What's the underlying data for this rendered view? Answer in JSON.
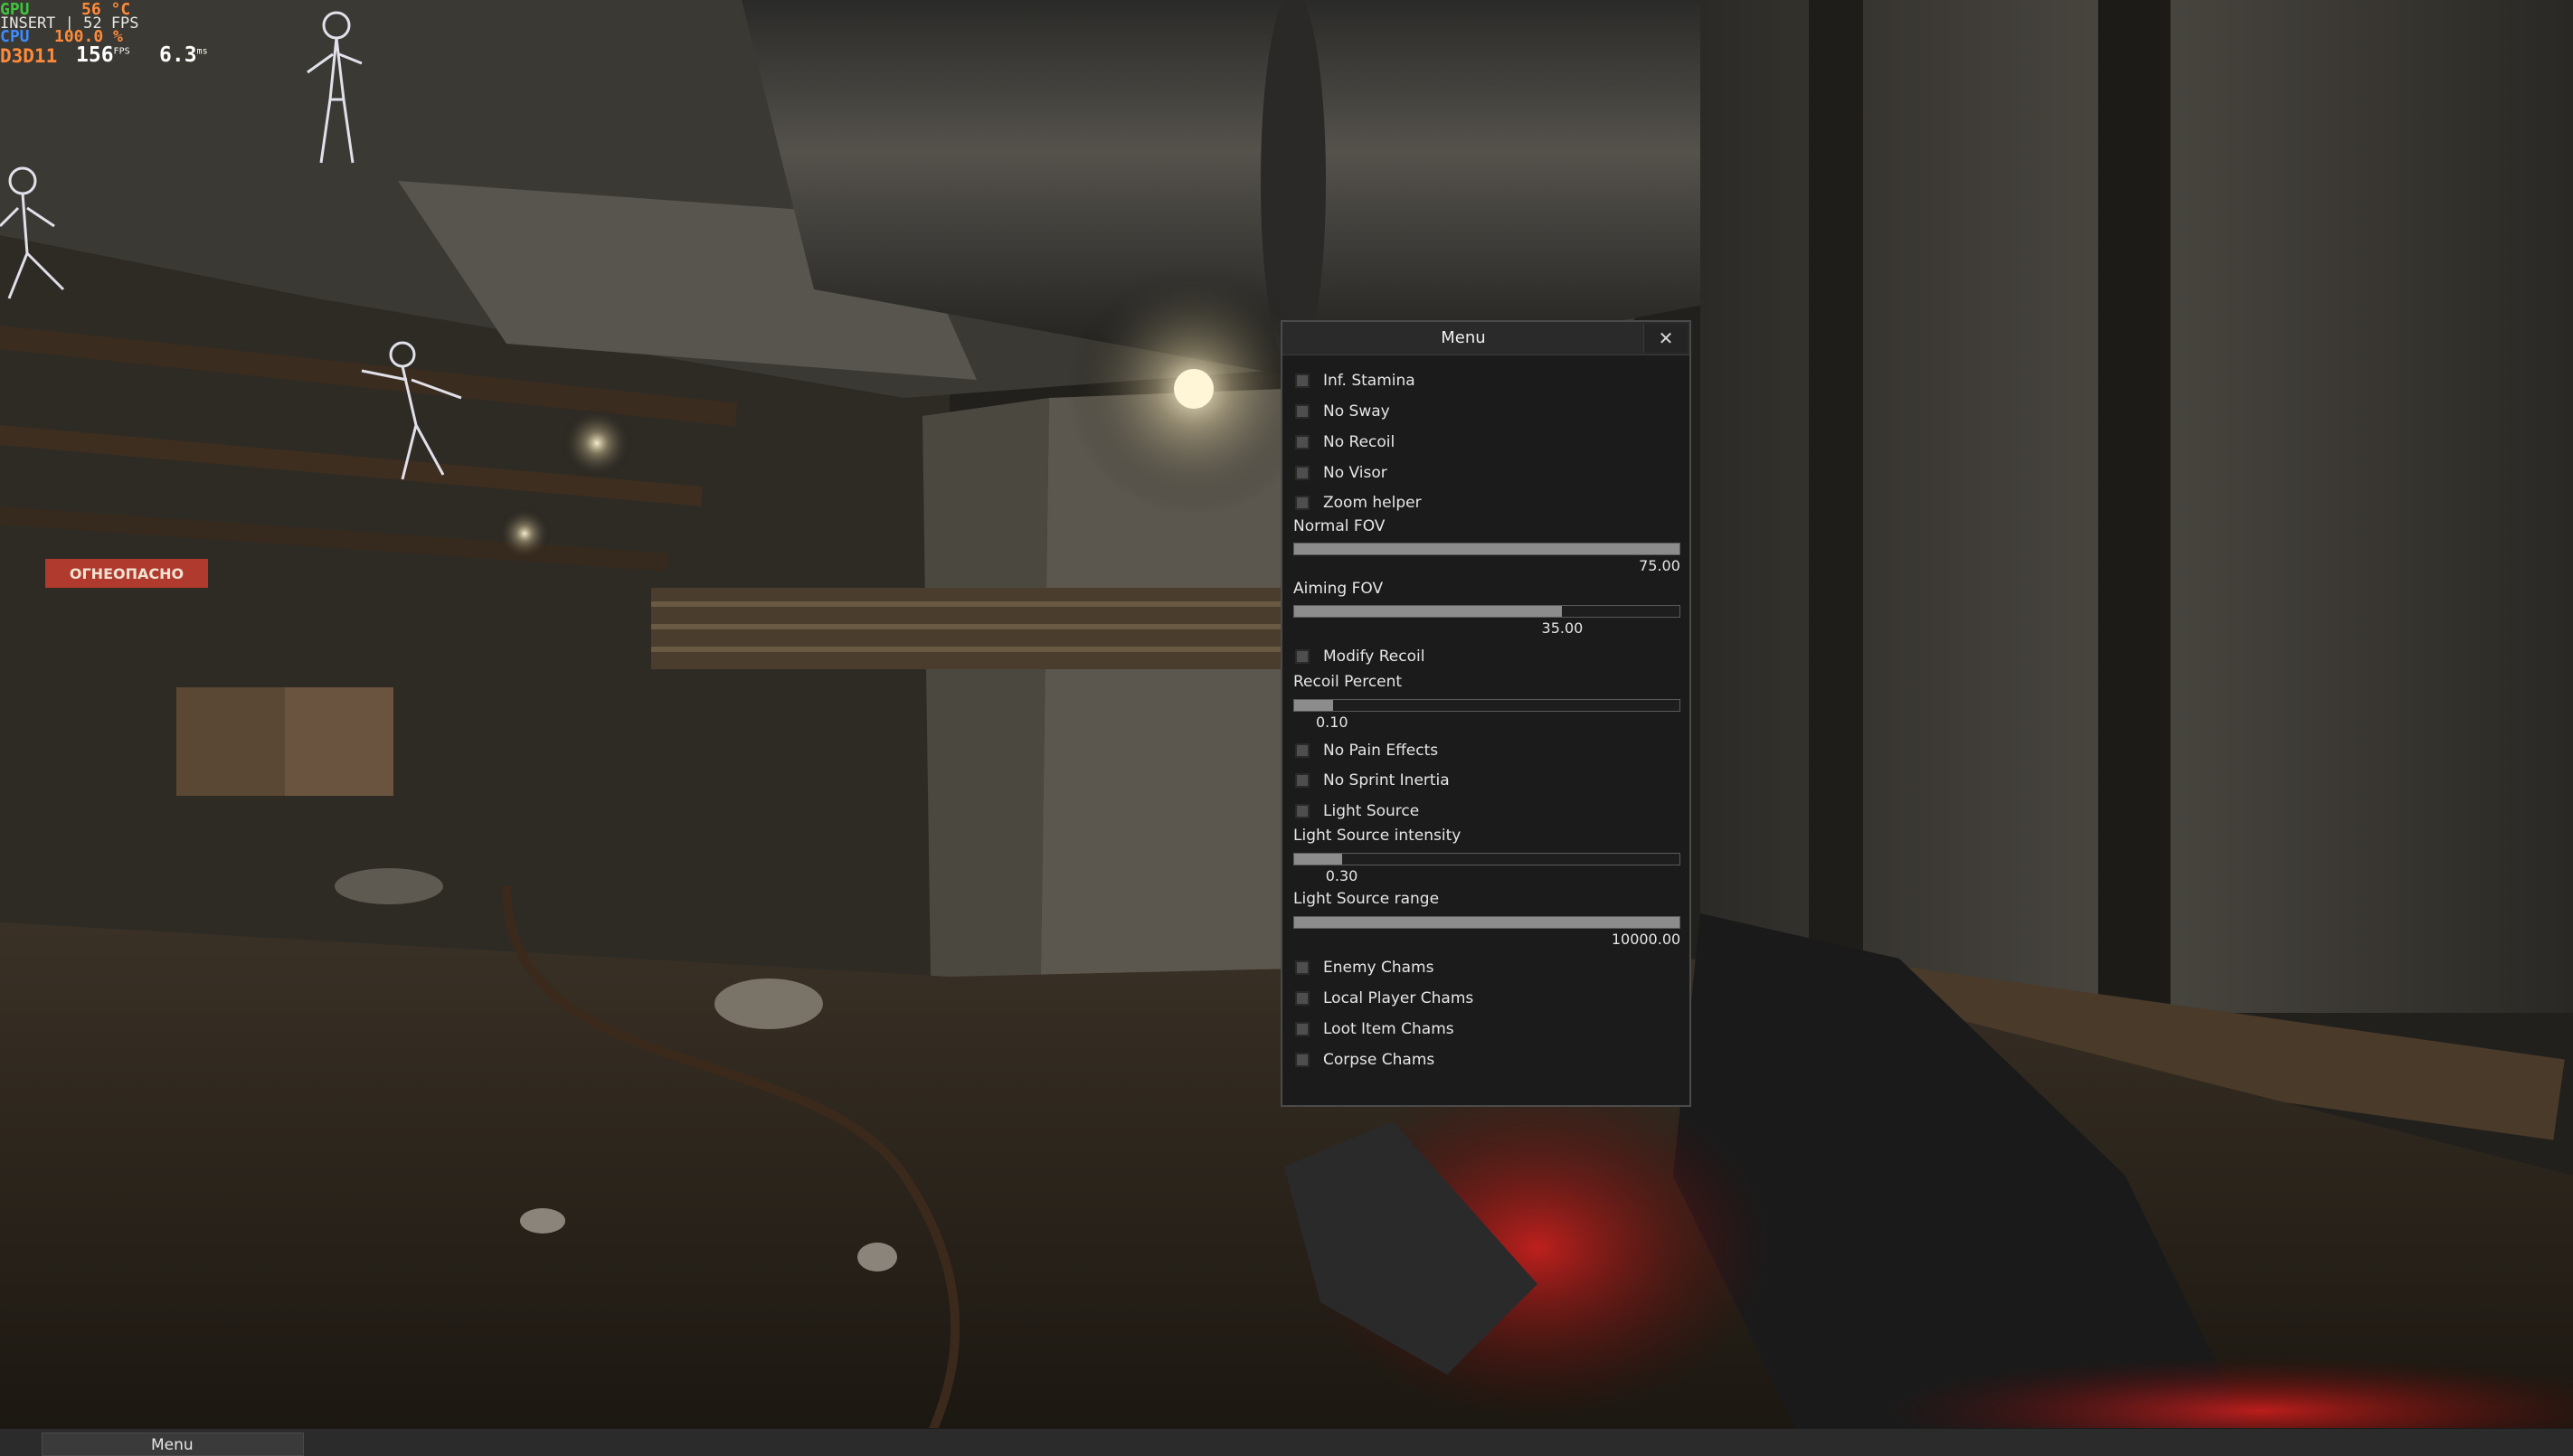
{
  "overlay": {
    "gpu_label": "GPU",
    "gpu_value": "56 °C",
    "hint": "INSERT | 52 FPS",
    "cpu_label": "CPU",
    "cpu_value": "100.0 %",
    "api": "D3D11",
    "fps_value": "156",
    "fps_unit": "FPS",
    "ms_value": "6.3",
    "ms_unit": "ms"
  },
  "scene": {
    "sign_text": "ОГНЕОПАСНО"
  },
  "menu": {
    "title": "Menu",
    "close_symbol": "✕",
    "checkboxes": [
      {
        "label": "Inf. Stamina",
        "checked": false
      },
      {
        "label": "No Sway",
        "checked": false
      },
      {
        "label": "No Recoil",
        "checked": false
      },
      {
        "label": "No Visor",
        "checked": false
      },
      {
        "label": "Zoom helper",
        "checked": false
      },
      {
        "label": "Modify Recoil",
        "checked": false
      },
      {
        "label": "No Pain Effects",
        "checked": false
      },
      {
        "label": "No Sprint Inertia",
        "checked": false
      },
      {
        "label": "Light Source",
        "checked": false
      },
      {
        "label": "Enemy Chams",
        "checked": false
      },
      {
        "label": "Local Player Chams",
        "checked": false
      },
      {
        "label": "Loot Item Chams",
        "checked": false
      },
      {
        "label": "Corpse Chams",
        "checked": false
      }
    ],
    "sliders": [
      {
        "label": "Normal FOV",
        "value_text": "75.00",
        "fill": 1.0
      },
      {
        "label": "Aiming FOV",
        "value_text": "35.00",
        "fill": 0.695
      },
      {
        "label": "Recoil Percent",
        "value_text": "0.10",
        "fill": 0.1
      },
      {
        "label": "Light Source intensity",
        "value_text": "0.30",
        "fill": 0.125
      },
      {
        "label": "Light Source range",
        "value_text": "10000.00",
        "fill": 1.0
      }
    ]
  },
  "taskbar": {
    "item_label": "Menu"
  }
}
